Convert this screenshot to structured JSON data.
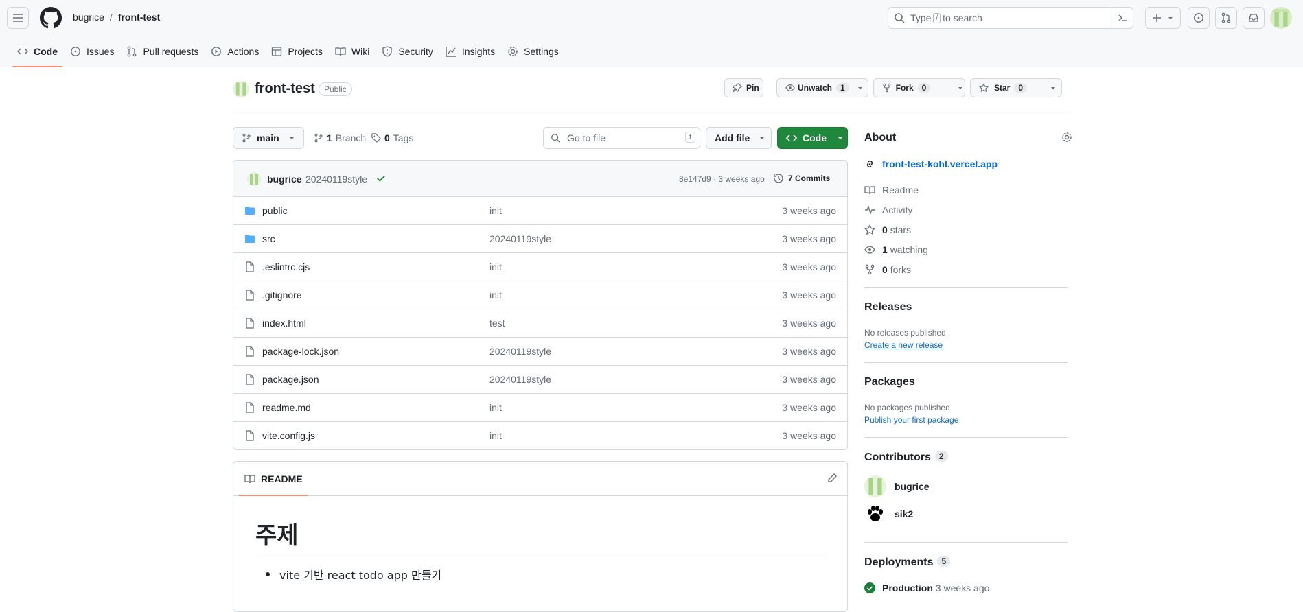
{
  "header": {
    "owner": "bugrice",
    "separator": "/",
    "repo": "front-test",
    "search_pre": "Type",
    "search_key": "/",
    "search_post": "to search"
  },
  "tabs": [
    {
      "label": "Code",
      "icon": "code-icon"
    },
    {
      "label": "Issues",
      "icon": "issue-icon"
    },
    {
      "label": "Pull requests",
      "icon": "pull-request-icon"
    },
    {
      "label": "Actions",
      "icon": "play-icon"
    },
    {
      "label": "Projects",
      "icon": "table-icon"
    },
    {
      "label": "Wiki",
      "icon": "book-icon"
    },
    {
      "label": "Security",
      "icon": "shield-icon"
    },
    {
      "label": "Insights",
      "icon": "graph-icon"
    },
    {
      "label": "Settings",
      "icon": "gear-icon"
    }
  ],
  "repo_head": {
    "name": "front-test",
    "visibility": "Public",
    "pin": "Pin",
    "unwatch": "Unwatch",
    "watch_count": "1",
    "fork": "Fork",
    "fork_count": "0",
    "star": "Star",
    "star_count": "0"
  },
  "branch_bar": {
    "branch": "main",
    "branch_count": "1",
    "branch_label": "Branch",
    "tag_count": "0",
    "tag_label": "Tags",
    "goto_placeholder": "Go to file",
    "goto_key": "t",
    "add_file": "Add file",
    "code": "Code"
  },
  "commit": {
    "user": "bugrice",
    "message": "20240119style",
    "hash_time": "8e147d9 · 3 weeks ago",
    "commits": "7 Commits"
  },
  "files": [
    {
      "name": "public",
      "type": "folder",
      "message": "init",
      "time": "3 weeks ago"
    },
    {
      "name": "src",
      "type": "folder",
      "message": "20240119style",
      "time": "3 weeks ago"
    },
    {
      "name": ".eslintrc.cjs",
      "type": "file",
      "message": "init",
      "time": "3 weeks ago"
    },
    {
      "name": ".gitignore",
      "type": "file",
      "message": "init",
      "time": "3 weeks ago"
    },
    {
      "name": "index.html",
      "type": "file",
      "message": "test",
      "time": "3 weeks ago"
    },
    {
      "name": "package-lock.json",
      "type": "file",
      "message": "20240119style",
      "time": "3 weeks ago"
    },
    {
      "name": "package.json",
      "type": "file",
      "message": "20240119style",
      "time": "3 weeks ago"
    },
    {
      "name": "readme.md",
      "type": "file",
      "message": "init",
      "time": "3 weeks ago"
    },
    {
      "name": "vite.config.js",
      "type": "file",
      "message": "init",
      "time": "3 weeks ago"
    }
  ],
  "readme": {
    "tab": "README",
    "heading": "주제",
    "bullet": "vite 기반 react todo app 만들기"
  },
  "about": {
    "title": "About",
    "website": "front-test-kohl.vercel.app",
    "readme": "Readme",
    "activity": "Activity",
    "stars_count": "0",
    "stars_label": "stars",
    "watching_count": "1",
    "watching_label": "watching",
    "forks_count": "0",
    "forks_label": "forks"
  },
  "releases": {
    "title": "Releases",
    "none": "No releases published",
    "create": "Create a new release"
  },
  "packages": {
    "title": "Packages",
    "none": "No packages published",
    "publish": "Publish your first package"
  },
  "contributors": {
    "title": "Contributors",
    "count": "2",
    "list": [
      {
        "name": "bugrice"
      },
      {
        "name": "sik2"
      }
    ]
  },
  "deployments": {
    "title": "Deployments",
    "count": "5",
    "env": "Production",
    "time": "3 weeks ago"
  },
  "colors": {
    "accent": "#fd8c73",
    "primary_button": "#1f883d",
    "link": "#0969da",
    "folder": "#54aeff"
  }
}
